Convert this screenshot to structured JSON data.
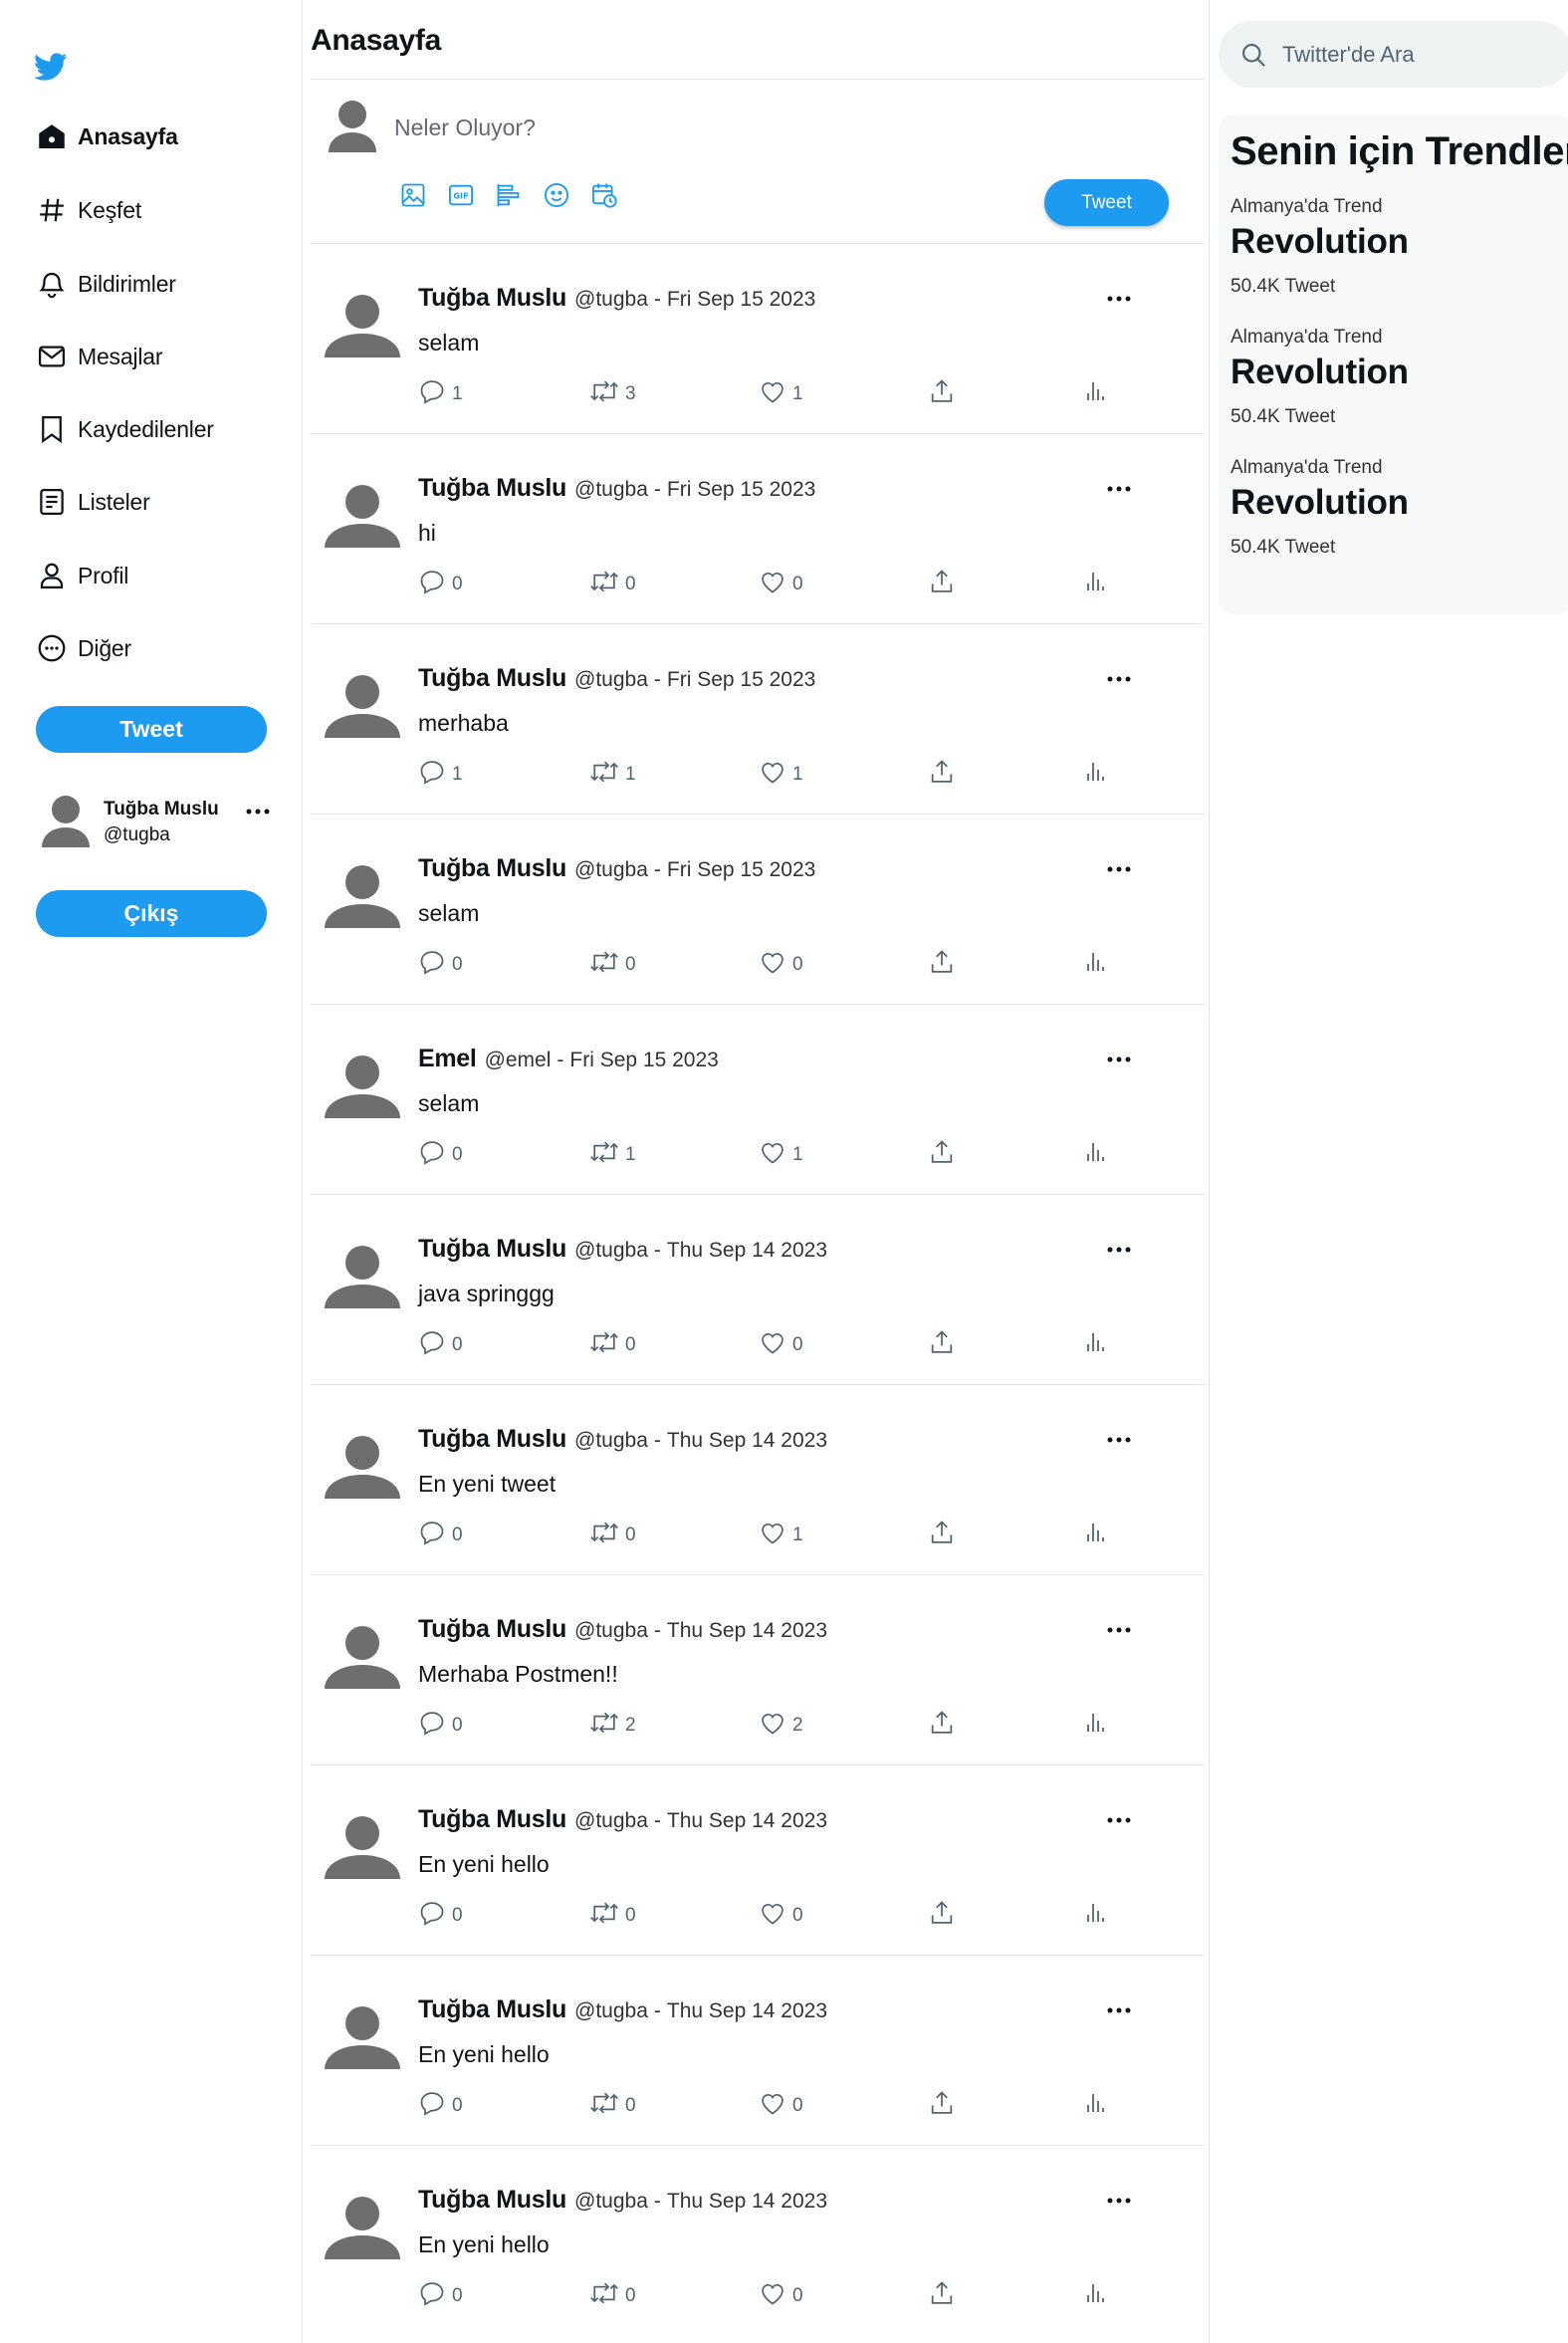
{
  "sidebar": {
    "nav": [
      {
        "label": "Anasayfa",
        "icon": "home-icon"
      },
      {
        "label": "Keşfet",
        "icon": "hashtag-icon"
      },
      {
        "label": "Bildirimler",
        "icon": "bell-icon"
      },
      {
        "label": "Mesajlar",
        "icon": "mail-icon"
      },
      {
        "label": "Kaydedilenler",
        "icon": "bookmark-icon"
      },
      {
        "label": "Listeler",
        "icon": "list-icon"
      },
      {
        "label": "Profil",
        "icon": "user-icon"
      },
      {
        "label": "Diğer",
        "icon": "more-circle-icon"
      }
    ],
    "tweet_button": "Tweet",
    "user": {
      "name": "Tuğba Muslu",
      "handle": "@tugba"
    },
    "logout_button": "Çıkış"
  },
  "main": {
    "title": "Anasayfa",
    "composer": {
      "placeholder": "Neler Oluyor?",
      "tweet_button": "Tweet",
      "tools": [
        "image-icon",
        "gif-icon",
        "poll-icon",
        "emoji-icon",
        "schedule-icon"
      ]
    },
    "tweets": [
      {
        "name": "Tuğba Muslu",
        "handle": "@tugba",
        "sep": "-",
        "date": "Fri Sep 15 2023",
        "text": "selam",
        "replies": "1",
        "retweets": "3",
        "likes": "1"
      },
      {
        "name": "Tuğba Muslu",
        "handle": "@tugba",
        "sep": "-",
        "date": "Fri Sep 15 2023",
        "text": "hi",
        "replies": "0",
        "retweets": "0",
        "likes": "0"
      },
      {
        "name": "Tuğba Muslu",
        "handle": "@tugba",
        "sep": "-",
        "date": "Fri Sep 15 2023",
        "text": "merhaba",
        "replies": "1",
        "retweets": "1",
        "likes": "1"
      },
      {
        "name": "Tuğba Muslu",
        "handle": "@tugba",
        "sep": "-",
        "date": "Fri Sep 15 2023",
        "text": "selam",
        "replies": "0",
        "retweets": "0",
        "likes": "0"
      },
      {
        "name": "Emel",
        "handle": "@emel",
        "sep": "-",
        "date": "Fri Sep 15 2023",
        "text": "selam",
        "replies": "0",
        "retweets": "1",
        "likes": "1"
      },
      {
        "name": "Tuğba Muslu",
        "handle": "@tugba",
        "sep": "-",
        "date": "Thu Sep 14 2023",
        "text": "java springgg",
        "replies": "0",
        "retweets": "0",
        "likes": "0"
      },
      {
        "name": "Tuğba Muslu",
        "handle": "@tugba",
        "sep": "-",
        "date": "Thu Sep 14 2023",
        "text": "En yeni tweet",
        "replies": "0",
        "retweets": "0",
        "likes": "1"
      },
      {
        "name": "Tuğba Muslu",
        "handle": "@tugba",
        "sep": "-",
        "date": "Thu Sep 14 2023",
        "text": "Merhaba Postmen!!",
        "replies": "0",
        "retweets": "2",
        "likes": "2"
      },
      {
        "name": "Tuğba Muslu",
        "handle": "@tugba",
        "sep": "-",
        "date": "Thu Sep 14 2023",
        "text": "En yeni hello",
        "replies": "0",
        "retweets": "0",
        "likes": "0"
      },
      {
        "name": "Tuğba Muslu",
        "handle": "@tugba",
        "sep": "-",
        "date": "Thu Sep 14 2023",
        "text": "En yeni hello",
        "replies": "0",
        "retweets": "0",
        "likes": "0"
      },
      {
        "name": "Tuğba Muslu",
        "handle": "@tugba",
        "sep": "-",
        "date": "Thu Sep 14 2023",
        "text": "En yeni hello",
        "replies": "0",
        "retweets": "0",
        "likes": "0"
      }
    ]
  },
  "right": {
    "search_placeholder": "Twitter'de Ara",
    "trends_title": "Senin için Trendler",
    "trends": [
      {
        "location": "Almanya'da Trend",
        "topic": "Revolution",
        "count": "50.4K Tweet"
      },
      {
        "location": "Almanya'da Trend",
        "topic": "Revolution",
        "count": "50.4K Tweet"
      },
      {
        "location": "Almanya'da Trend",
        "topic": "Revolution",
        "count": "50.4K Tweet"
      }
    ]
  },
  "colors": {
    "accent": "#1d9bf0",
    "avatar": "#6e6e6e",
    "text": "#0f1419",
    "muted": "#536471"
  }
}
